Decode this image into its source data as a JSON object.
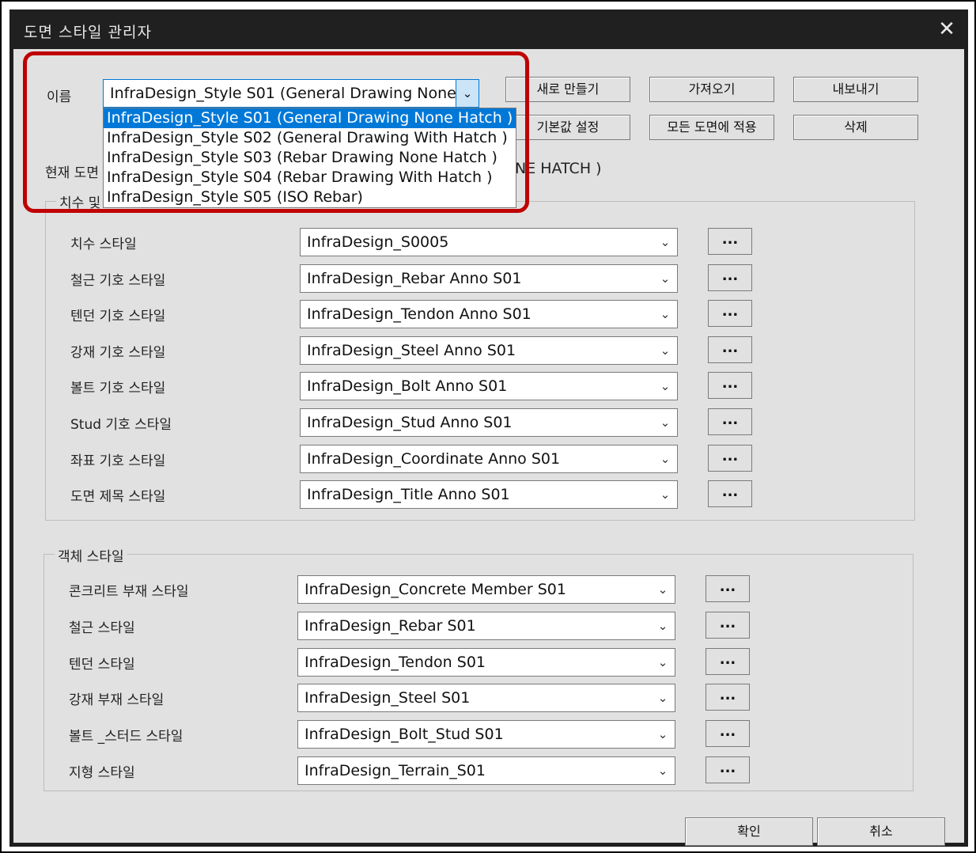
{
  "window": {
    "title": "도면 스타일 관리자"
  },
  "name": {
    "label": "이름",
    "selected": "InfraDesign_Style S01 (General Drawing None Hatch )",
    "options": [
      "InfraDesign_Style S01 (General Drawing None Hatch )",
      "InfraDesign_Style S02 (General Drawing With Hatch )",
      "InfraDesign_Style S03 (Rebar Drawing None Hatch )",
      "InfraDesign_Style S04 (Rebar Drawing With Hatch )",
      "InfraDesign_Style S05 (ISO Rebar)"
    ]
  },
  "buttons": {
    "new": "새로 만들기",
    "import": "가져오기",
    "export": "내보내기",
    "set_default": "기본값 설정",
    "apply_all": "모든 도면에 적용",
    "delete": "삭제",
    "ok": "확인",
    "cancel": "취소",
    "more": "..."
  },
  "current": {
    "label_partial": "현재 도면",
    "value_partial": "NE HATCH )"
  },
  "annotation_group": {
    "title_partial": "치수 및",
    "rows": [
      {
        "label": "치수 스타일",
        "value": "InfraDesign_S0005"
      },
      {
        "label": "철근 기호 스타일",
        "value": "InfraDesign_Rebar Anno S01"
      },
      {
        "label": "텐던 기호 스타일",
        "value": "InfraDesign_Tendon Anno S01"
      },
      {
        "label": "강재 기호 스타일",
        "value": "InfraDesign_Steel Anno S01"
      },
      {
        "label": "볼트 기호 스타일",
        "value": "InfraDesign_Bolt Anno S01"
      },
      {
        "label": "Stud 기호 스타일",
        "value": "InfraDesign_Stud Anno S01"
      },
      {
        "label": "좌표 기호 스타일",
        "value": "InfraDesign_Coordinate Anno S01"
      },
      {
        "label": "도면 제목 스타일",
        "value": "InfraDesign_Title Anno S01"
      }
    ]
  },
  "object_group": {
    "title": "객체 스타일",
    "rows": [
      {
        "label": "콘크리트 부재 스타일",
        "value": "InfraDesign_Concrete Member S01"
      },
      {
        "label": "철근 스타일",
        "value": "InfraDesign_Rebar S01"
      },
      {
        "label": "텐던 스타일",
        "value": "InfraDesign_Tendon S01"
      },
      {
        "label": "강재 부재 스타일",
        "value": "InfraDesign_Steel S01"
      },
      {
        "label": "볼트 _스터드 스타일",
        "value": "InfraDesign_Bolt_Stud S01"
      },
      {
        "label": "지형 스타일",
        "value": "InfraDesign_Terrain_S01"
      }
    ]
  },
  "icons": {
    "close": "close-icon",
    "dropdown": "chevron-down-icon"
  },
  "colors": {
    "selection": "#0078d7",
    "highlight": "#c00000",
    "titlebar": "#202020",
    "dialog": "#e1e1e1"
  }
}
